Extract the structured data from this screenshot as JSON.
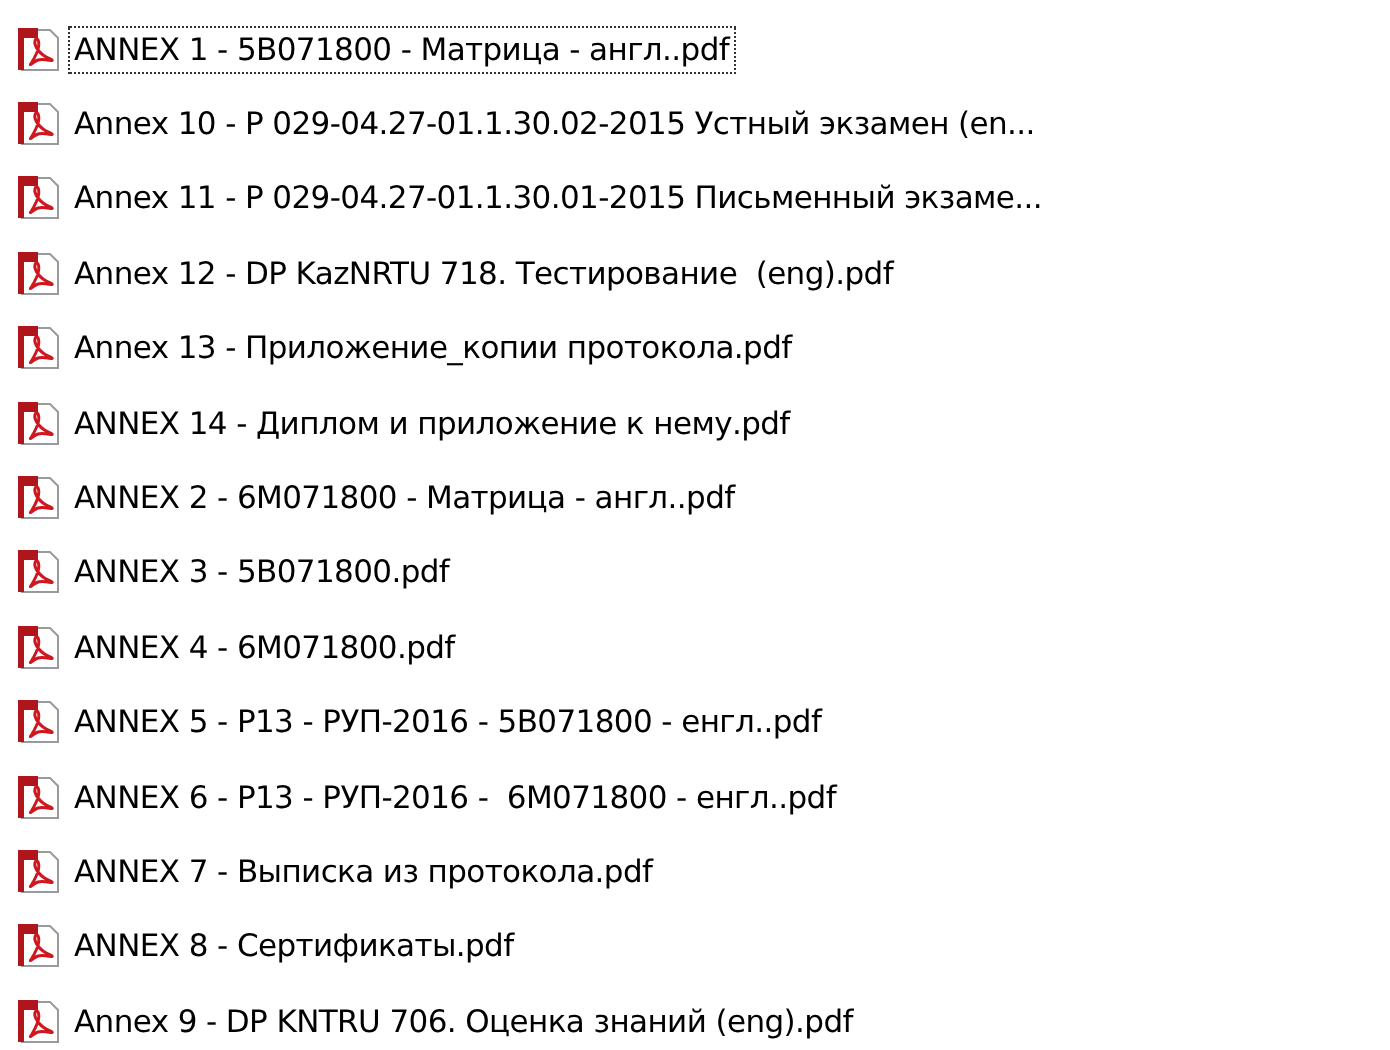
{
  "files": [
    {
      "name": "ANNEX 1 - 5B071800 - Матрица - англ..pdf",
      "focused": true
    },
    {
      "name": "Annex 10 - P 029-04.27-01.1.30.02-2015 Устный экзамен (en...",
      "focused": false
    },
    {
      "name": "Annex 11 - P 029-04.27-01.1.30.01-2015 Письменный экзаме...",
      "focused": false
    },
    {
      "name": "Annex 12 - DP KazNRTU 718. Тестирование  (eng).pdf",
      "focused": false
    },
    {
      "name": "Annex 13 - Приложение_копии протокола.pdf",
      "focused": false
    },
    {
      "name": "ANNEX 14 - Диплом и приложение к нему.pdf",
      "focused": false
    },
    {
      "name": "ANNEX 2 - 6M071800 - Матрица - англ..pdf",
      "focused": false
    },
    {
      "name": "ANNEX 3 - 5B071800.pdf",
      "focused": false
    },
    {
      "name": "ANNEX 4 - 6M071800.pdf",
      "focused": false
    },
    {
      "name": "ANNEX 5 - P13 - РУП-2016 - 5B071800 - енгл..pdf",
      "focused": false
    },
    {
      "name": "ANNEX 6 - P13 - РУП-2016 -  6M071800 - енгл..pdf",
      "focused": false
    },
    {
      "name": "ANNEX 7 - Выписка из протокола.pdf",
      "focused": false
    },
    {
      "name": "ANNEX 8 - Сертификаты.pdf",
      "focused": false
    },
    {
      "name": "Annex 9 - DP KNTRU 706. Оценка знаний (eng).pdf",
      "focused": false
    }
  ]
}
